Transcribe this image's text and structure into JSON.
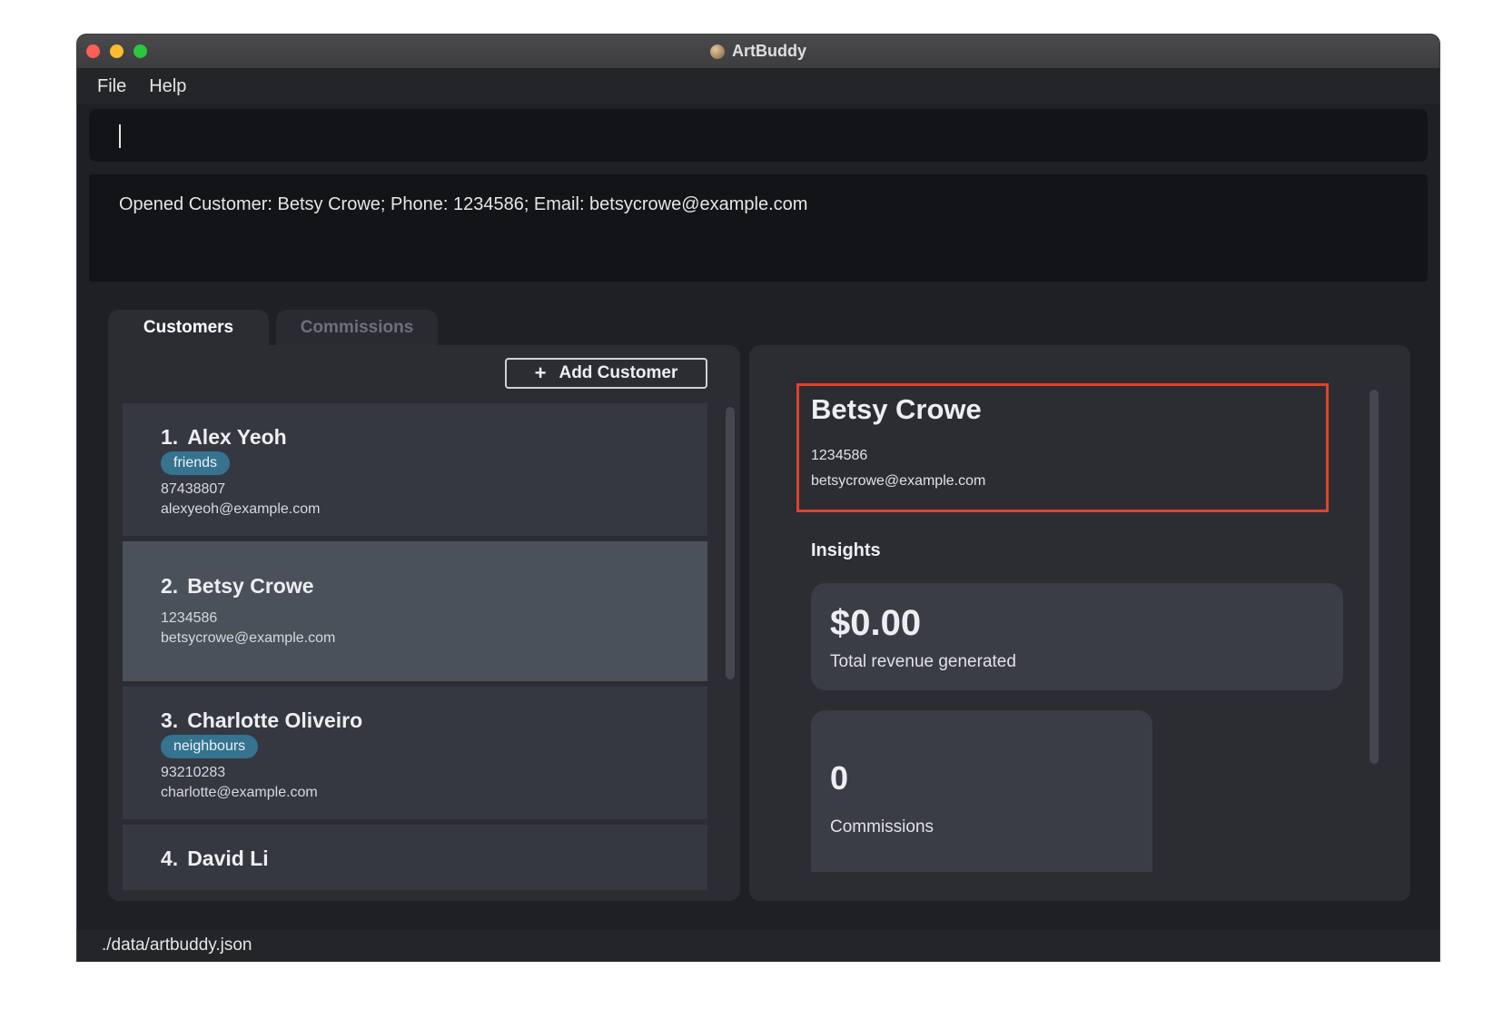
{
  "window": {
    "title": "ArtBuddy",
    "icon": "palette-icon"
  },
  "menu": {
    "file": "File",
    "help": "Help"
  },
  "command": {
    "value": ""
  },
  "result": {
    "message": "Opened Customer: Betsy Crowe; Phone: 1234586; Email: betsycrowe@example.com"
  },
  "tabs": [
    {
      "label": "Customers",
      "active": true
    },
    {
      "label": "Commissions",
      "active": false
    }
  ],
  "add_customer": {
    "icon": "+",
    "label": "Add Customer"
  },
  "customers": [
    {
      "index": "1.",
      "name": "Alex Yeoh",
      "tag": "friends",
      "phone": "87438807",
      "email": "alexyeoh@example.com"
    },
    {
      "index": "2.",
      "name": "Betsy Crowe",
      "tag": "",
      "phone": "1234586",
      "email": "betsycrowe@example.com",
      "selected": true
    },
    {
      "index": "3.",
      "name": "Charlotte Oliveiro",
      "tag": "neighbours",
      "phone": "93210283",
      "email": "charlotte@example.com"
    },
    {
      "index": "4.",
      "name": "David Li"
    }
  ],
  "detail": {
    "name": "Betsy Crowe",
    "phone": "1234586",
    "email": "betsycrowe@example.com",
    "insights_label": "Insights",
    "revenue_value": "$0.00",
    "revenue_label": "Total revenue generated",
    "commissions_value": "0",
    "commissions_label": "Commissions"
  },
  "status": {
    "file_path": "./data/artbuddy.json"
  },
  "colors": {
    "tag": "#35738e",
    "highlight": "#e0422b",
    "selected_card": "#4b515b"
  }
}
